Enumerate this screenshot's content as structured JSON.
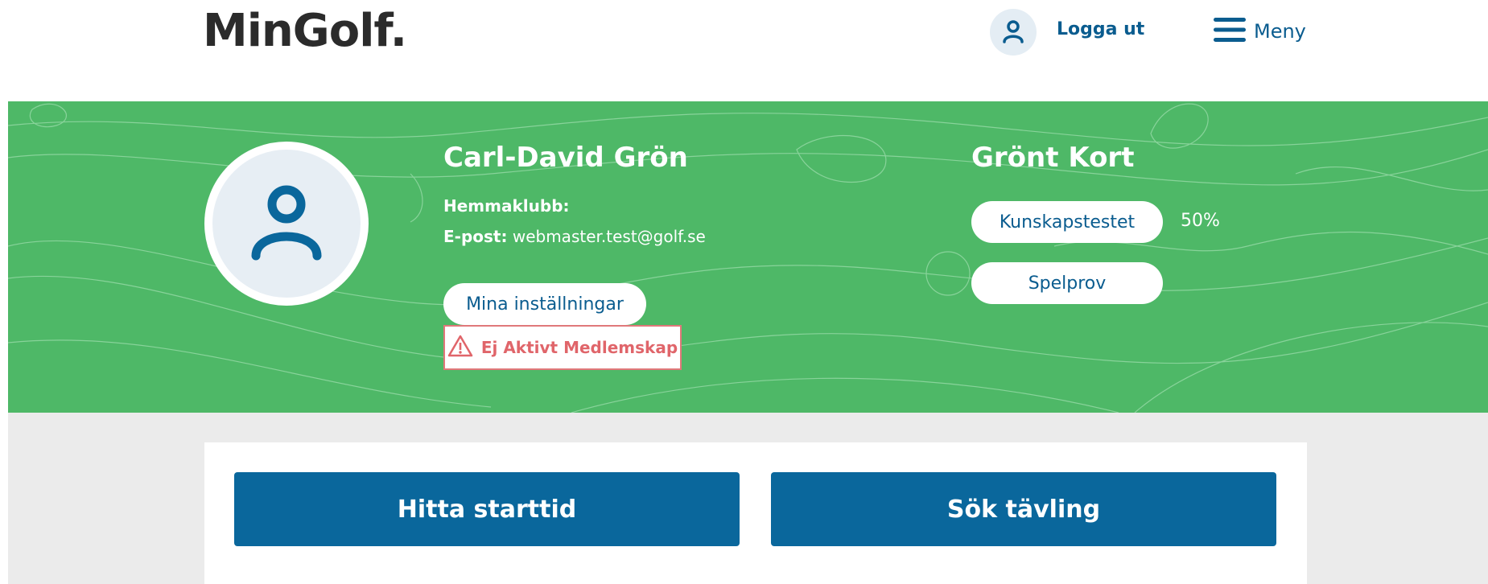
{
  "header": {
    "logo": "MinGolf.",
    "logout_label": "Logga ut",
    "menu_label": "Meny"
  },
  "profile": {
    "name": "Carl-David Grön",
    "home_club_label": "Hemmaklubb:",
    "home_club_value": "",
    "email_label": "E-post:",
    "email_value": "webmaster.test@golf.se",
    "settings_button": "Mina inställningar",
    "membership_warning": "Ej Aktivt Medlemskap"
  },
  "green_card": {
    "title": "Grönt Kort",
    "knowledge_test_button": "Kunskapstestet",
    "knowledge_test_progress": "50%",
    "play_test_button": "Spelprov"
  },
  "actions": {
    "find_tee_time": "Hitta starttid",
    "search_competition": "Sök tävling"
  },
  "colors": {
    "brand_blue": "#0a679c",
    "hero_green": "#4eb867",
    "warning_red": "#e0656a"
  }
}
